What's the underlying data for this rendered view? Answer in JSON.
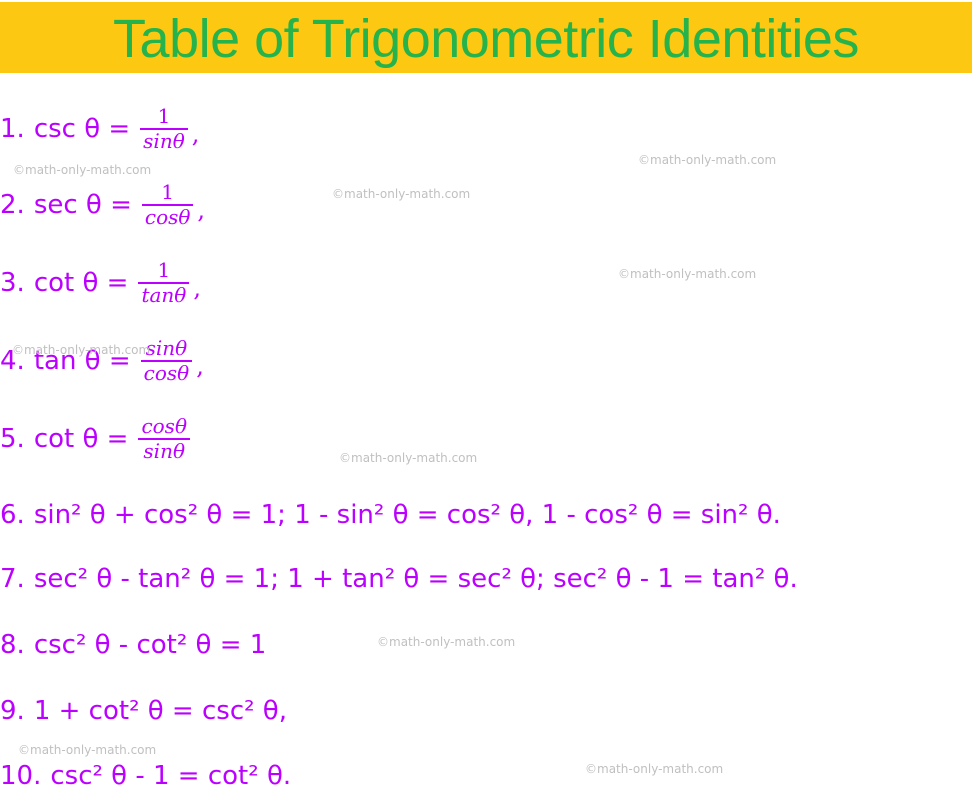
{
  "title": "Table of Trigonometric Identities",
  "colors": {
    "header_bg": "#fcc812",
    "title": "#27b34b",
    "text": "#bb00ff",
    "watermark": "#c0c0c0"
  },
  "watermark": "©math-only-math.com",
  "identities": [
    {
      "num": "1.",
      "lhs": "csc θ =",
      "numerator": "1",
      "denominator": "sinθ",
      "tail": ","
    },
    {
      "num": "2.",
      "lhs": "sec θ =",
      "numerator": "1",
      "denominator": "cosθ",
      "tail": ","
    },
    {
      "num": "3.",
      "lhs": "cot θ =",
      "numerator": "1",
      "denominator": "tanθ",
      "tail": ","
    },
    {
      "num": "4.",
      "lhs": "tan θ =",
      "numerator": "sinθ",
      "denominator": "cosθ",
      "tail": ","
    },
    {
      "num": "5.",
      "lhs": "cot θ =",
      "numerator": "cosθ",
      "denominator": "sinθ",
      "tail": ""
    },
    {
      "num": "6.",
      "text": "sin² θ + cos² θ = 1; 1 - sin² θ = cos² θ, 1 - cos² θ = sin² θ."
    },
    {
      "num": "7.",
      "text": "sec² θ - tan² θ = 1; 1 + tan² θ = sec² θ; sec² θ - 1 = tan² θ."
    },
    {
      "num": "8.",
      "text": "csc² θ - cot² θ = 1"
    },
    {
      "num": "9.",
      "text": "1 + cot² θ = csc² θ,"
    },
    {
      "num": "10.",
      "text": "csc² θ - 1 = cot² θ."
    }
  ]
}
